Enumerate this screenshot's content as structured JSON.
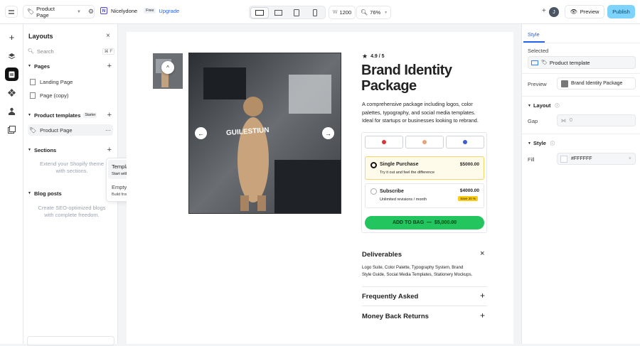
{
  "topbar": {
    "page_select": "Product Page",
    "site_name": "Nicelydone",
    "site_initial": "N",
    "plan_badge": "Free",
    "upgrade_label": "Upgrade",
    "width_label": "W",
    "width_value": "1200",
    "zoom_value": "76%",
    "avatar_initial": "J",
    "preview_label": "Preview",
    "publish_label": "Publish"
  },
  "layouts": {
    "title": "Layouts",
    "search_placeholder": "Search",
    "search_shortcut": "⌘ F",
    "pages_label": "Pages",
    "pages": [
      "Landing Page",
      "Page (copy)"
    ],
    "product_templates_label": "Product templates",
    "starter_badge": "Starter",
    "product_page": "Product Page",
    "sections_label": "Sections",
    "sections_empty": "Extend your Shopify theme with sections.",
    "blog_label": "Blog posts",
    "blog_empty": "Create SEO-optimized blogs with complete freedom."
  },
  "popup": {
    "item1_title": "Template library",
    "item1_sub": "Start with a template",
    "item2_title": "Empty",
    "item2_sub": "Build from scratch"
  },
  "product": {
    "rating": "4.9 / 5",
    "title_line1": "Brand Identity",
    "title_line2": "Package",
    "desc_lines": [
      "A comprehensive package including logos, color",
      "palettes, typography, and social media templates.",
      "Ideal for startups or businesses looking to rebrand."
    ],
    "image_text": "GUILESTIUN",
    "option1_title": "Single Purchase",
    "option1_sub": "Try it out and feel the difference",
    "option1_price": "$5000.00",
    "option2_title": "Subscribe",
    "option2_sub": "Unlimited revisions / month",
    "option2_price": "$4000.00",
    "option2_badge": "Save 20 %",
    "add_to_bag": "ADD TO BAG  —  $5,000.00",
    "deliverables_title": "Deliverables",
    "deliverables_lines": [
      "Logo Suite, Color Palette, Typography System, Brand",
      "Style Guide, Social Media Templates, Stationery Mockups."
    ],
    "faq_title": "Frequently Asked",
    "money_back_title": "Money Back Returns"
  },
  "inspector": {
    "tab_style": "Style",
    "selected_label": "Selected",
    "selected_value": "Product template",
    "preview_label": "Preview",
    "preview_value": "Brand Identity Package",
    "layout_label": "Layout",
    "gap_label": "Gap",
    "gap_value": "0",
    "style_label": "Style",
    "fill_label": "Fill",
    "fill_value": "#FFFFFF"
  },
  "colors": {
    "accent": "#3b82f6",
    "publish_bg": "#7dd3fc",
    "cta_green": "#22c55e",
    "option_selected_bg": "#fffbeb",
    "option_selected_border": "#f5d46b",
    "badge_yellow": "#facc15"
  }
}
